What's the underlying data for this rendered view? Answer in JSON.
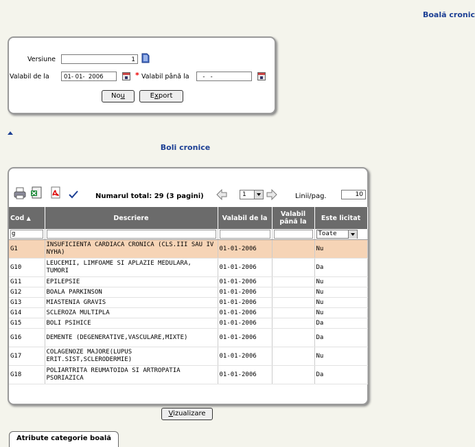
{
  "page": {
    "title": "Boală cronic"
  },
  "form": {
    "version_label": "Versiune",
    "version_value": "1",
    "valid_from_label": "Valabil de la",
    "valid_from_value": "01- 01-  2006",
    "required_mark": "*",
    "valid_to_label": "Valabil până la",
    "valid_to_value": "  -   -",
    "new_button": {
      "pre": "No",
      "hot": "u",
      "post": ""
    },
    "export_button": {
      "pre": "E",
      "hot": "x",
      "post": "port"
    }
  },
  "section": {
    "title": "Boli cronice"
  },
  "toolbar": {
    "total_text": "Numarul total: 29 (3 pagini)",
    "page_value": "1",
    "lines_per_page_label": "Linii/pag.",
    "lines_per_page_value": "10"
  },
  "table": {
    "headers": [
      "Cod",
      "Descriere",
      "Valabil de la",
      "Valabil până la",
      "Este licitat"
    ],
    "filter": {
      "cod": "g",
      "licitat": "Toate"
    },
    "rows": [
      {
        "cod": "G1",
        "descriere": "INSUFICIENTA CARDIACA CRONICA (CLS.III SAU IV NYHA)",
        "valabil_de_la": "01-01-2006",
        "valabil_pana_la": "",
        "licitat": "Nu"
      },
      {
        "cod": "G10",
        "descriere": "LEUCEMII, LIMFOAME SI APLAZIE MEDULARA, TUMORI",
        "valabil_de_la": "01-01-2006",
        "valabil_pana_la": "",
        "licitat": "Da"
      },
      {
        "cod": "G11",
        "descriere": "EPILEPSIE",
        "valabil_de_la": "01-01-2006",
        "valabil_pana_la": "",
        "licitat": "Nu"
      },
      {
        "cod": "G12",
        "descriere": "BOALA PARKINSON",
        "valabil_de_la": "01-01-2006",
        "valabil_pana_la": "",
        "licitat": "Nu"
      },
      {
        "cod": "G13",
        "descriere": "MIASTENIA GRAVIS",
        "valabil_de_la": "01-01-2006",
        "valabil_pana_la": "",
        "licitat": "Nu"
      },
      {
        "cod": "G14",
        "descriere": "SCLEROZA MULTIPLA",
        "valabil_de_la": "01-01-2006",
        "valabil_pana_la": "",
        "licitat": "Nu"
      },
      {
        "cod": "G15",
        "descriere": "BOLI PSIHICE",
        "valabil_de_la": "01-01-2006",
        "valabil_pana_la": "",
        "licitat": "Da"
      },
      {
        "cod": "G16",
        "descriere": "DEMENTE (DEGENERATIVE,VASCULARE,MIXTE)",
        "valabil_de_la": "01-01-2006",
        "valabil_pana_la": "",
        "licitat": "Da"
      },
      {
        "cod": "G17",
        "descriere": "COLAGENOZE MAJORE(LUPUS ERIT.SIST,SCLERODERMIE)",
        "valabil_de_la": "01-01-2006",
        "valabil_pana_la": "",
        "licitat": "Nu"
      },
      {
        "cod": "G18",
        "descriere": "POLIARTRITA REUMATOIDA SI ARTROPATIA PSORIAZICA",
        "valabil_de_la": "01-01-2006",
        "valabil_pana_la": "",
        "licitat": "Da"
      }
    ]
  },
  "view_button": {
    "hot": "V",
    "post": "izualizare"
  },
  "tab": {
    "label": "Atribute categorie boală"
  }
}
